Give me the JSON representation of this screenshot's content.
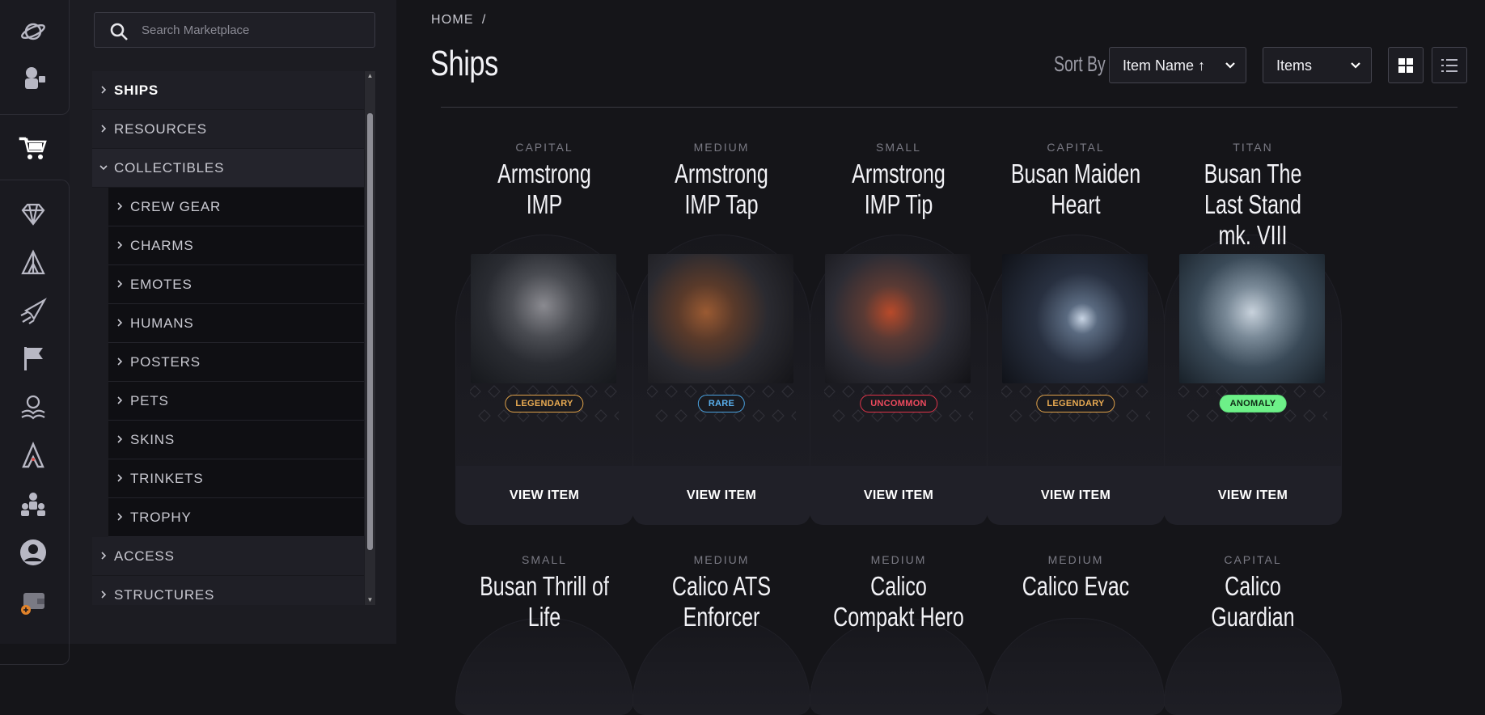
{
  "rail": {
    "icons": [
      "planet-icon",
      "astronaut-icon",
      "cart-icon",
      "gem-icon",
      "tent-icon",
      "rocket-icon",
      "flag-icon",
      "book-icon",
      "faction-icon",
      "crew-icon",
      "profile-icon",
      "wallet-icon"
    ],
    "active": "cart-icon"
  },
  "search": {
    "placeholder": "Search Marketplace"
  },
  "categories": {
    "items": [
      {
        "label": "SHIPS",
        "level": 0,
        "state": "current"
      },
      {
        "label": "RESOURCES",
        "level": 0
      },
      {
        "label": "COLLECTIBLES",
        "level": 0,
        "state": "open"
      },
      {
        "label": "CREW GEAR",
        "level": 1
      },
      {
        "label": "CHARMS",
        "level": 1
      },
      {
        "label": "EMOTES",
        "level": 1
      },
      {
        "label": "HUMANS",
        "level": 1
      },
      {
        "label": "POSTERS",
        "level": 1
      },
      {
        "label": "PETS",
        "level": 1
      },
      {
        "label": "SKINS",
        "level": 1
      },
      {
        "label": "TRINKETS",
        "level": 1
      },
      {
        "label": "TROPHY",
        "level": 1
      },
      {
        "label": "ACCESS",
        "level": 0
      },
      {
        "label": "STRUCTURES",
        "level": 0
      }
    ]
  },
  "header": {
    "breadcrumb": "HOME",
    "breadcrumb_sep": "/",
    "title": "Ships",
    "sort_label": "Sort By",
    "sort_value": "Item Name ↑",
    "type_value": "Items"
  },
  "cards": [
    {
      "size": "CAPITAL",
      "name": "Armstrong IMP",
      "rarity": "LEGENDARY",
      "rarity_class": "legendary",
      "cta": "VIEW ITEM"
    },
    {
      "size": "MEDIUM",
      "name": "Armstrong IMP Tap",
      "rarity": "RARE",
      "rarity_class": "rare",
      "cta": "VIEW ITEM"
    },
    {
      "size": "SMALL",
      "name": "Armstrong IMP Tip",
      "rarity": "UNCOMMON",
      "rarity_class": "uncommon",
      "cta": "VIEW ITEM"
    },
    {
      "size": "CAPITAL",
      "name": "Busan Maiden Heart",
      "rarity": "LEGENDARY",
      "rarity_class": "legendary",
      "cta": "VIEW ITEM"
    },
    {
      "size": "TITAN",
      "name": "Busan The Last Stand mk. VIII",
      "rarity": "ANOMALY",
      "rarity_class": "anomaly",
      "cta": "VIEW ITEM"
    }
  ],
  "cards_row2": [
    {
      "size": "SMALL",
      "name": "Busan Thrill of Life"
    },
    {
      "size": "MEDIUM",
      "name": "Calico ATS Enforcer"
    },
    {
      "size": "MEDIUM",
      "name": "Calico Compakt Hero"
    },
    {
      "size": "MEDIUM",
      "name": "Calico Evac"
    },
    {
      "size": "CAPITAL",
      "name": "Calico Guardian"
    }
  ],
  "colors": {
    "legendary": "#e0a24a",
    "rare": "#4aa2e0",
    "uncommon": "#e0344a",
    "anomaly": "#6df088"
  }
}
